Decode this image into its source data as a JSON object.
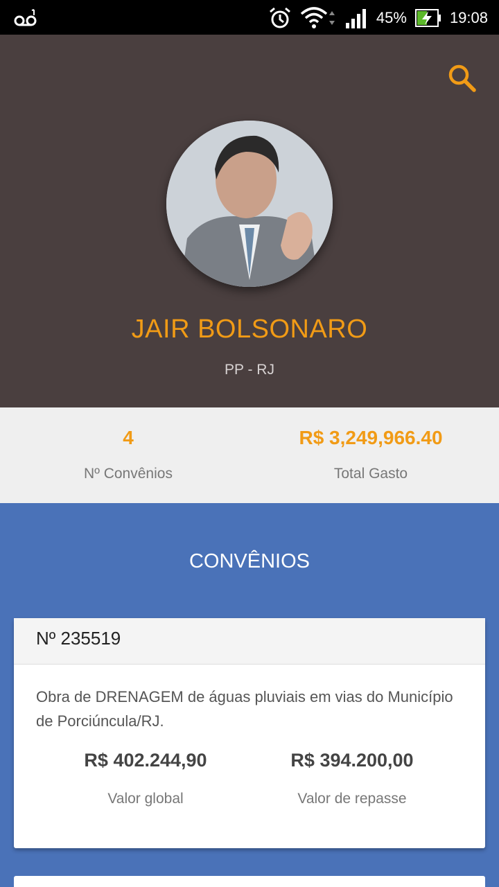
{
  "status_bar": {
    "battery": "45%",
    "time": "19:08"
  },
  "profile": {
    "name": "JAIR BOLSONARO",
    "party": "PP - RJ"
  },
  "stats": {
    "convenios_count": "4",
    "convenios_label": "Nº Convênios",
    "total": "R$ 3,249,966.40",
    "total_label": "Total Gasto"
  },
  "section_title": "CONVÊNIOS",
  "convenios": [
    {
      "number": "Nº 235519",
      "description": "Obra de DRENAGEM de águas pluviais em vias do Município de Porciúncula/RJ.",
      "global_value": "R$ 402.244,90",
      "global_label": "Valor global",
      "repasse_value": "R$ 394.200,00",
      "repasse_label": "Valor de repasse"
    }
  ],
  "colors": {
    "accent": "#f19b16",
    "hero_bg": "#4a3f3f",
    "section_bg": "#4a72b8"
  }
}
